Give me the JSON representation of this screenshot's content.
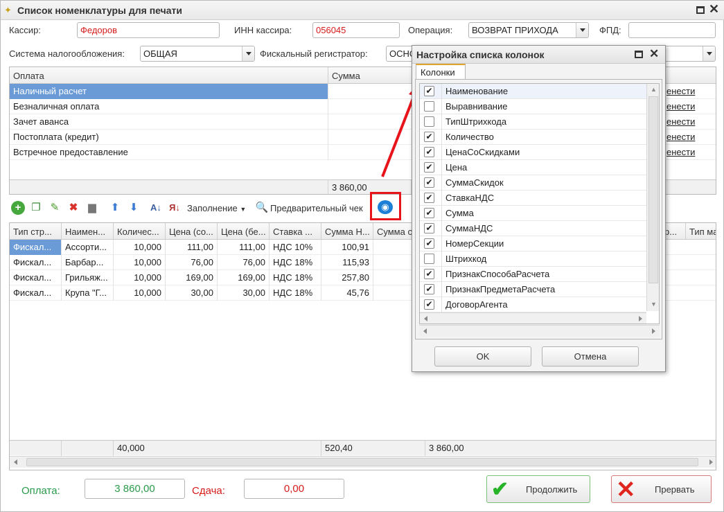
{
  "window": {
    "title": "Список номенклатуры для печати"
  },
  "form": {
    "cashier_label": "Кассир:",
    "cashier_value": "Федоров",
    "inn_label": "ИНН кассира:",
    "inn_value": "056045",
    "operation_label": "Операция:",
    "operation_value": "ВОЗВРАТ ПРИХОДА",
    "fpd_label": "ФПД:",
    "fpd_value": "",
    "tax_label": "Система налогообложения:",
    "tax_value": "ОБЩАЯ",
    "registrar_label": "Фискальный регистратор:",
    "registrar_value": "ОСНО"
  },
  "payments": {
    "headers": [
      "Оплата",
      "Сумма"
    ],
    "rows": [
      {
        "name": "Наличный расчет",
        "link": "енести"
      },
      {
        "name": "Безналичная оплата",
        "link": "енести"
      },
      {
        "name": "Зачет аванса",
        "link": "енести"
      },
      {
        "name": "Постоплата (кредит)",
        "link": "енести"
      },
      {
        "name": "Встречное предоставление",
        "link": "енести"
      }
    ],
    "total": "3 860,00"
  },
  "toolbar": {
    "fill_label": "Заполнение",
    "preview_label": "Предварительный чек"
  },
  "items": {
    "headers": [
      "Тип стр...",
      "Наимен...",
      "Количес...",
      "Цена (со...",
      "Цена (бе...",
      "Ставка ...",
      "Сумма Н...",
      "Сумма с",
      "р...",
      "Тип ма"
    ],
    "rows": [
      [
        "Фискал...",
        "Ассорти...",
        "10,000",
        "111,00",
        "111,00",
        "НДС 10%",
        "100,91"
      ],
      [
        "Фискал...",
        "Барбар...",
        "10,000",
        "76,00",
        "76,00",
        "НДС 18%",
        "115,93"
      ],
      [
        "Фискал...",
        "Грильяж...",
        "10,000",
        "169,00",
        "169,00",
        "НДС 18%",
        "257,80"
      ],
      [
        "Фискал...",
        "Крупа \"Г...",
        "10,000",
        "30,00",
        "30,00",
        "НДС 18%",
        "45,76"
      ]
    ],
    "totals": {
      "qty": "40,000",
      "sum_n": "520,40",
      "sum_c": "3 860,00"
    }
  },
  "bottom": {
    "payment_label": "Оплата:",
    "payment_value": "3 860,00",
    "change_label": "Сдача:",
    "change_value": "0,00",
    "continue_label": "Продолжить",
    "abort_label": "Прервать"
  },
  "dialog": {
    "title": "Настройка списка колонок",
    "tab": "Колонки",
    "columns": [
      {
        "name": "Наименование",
        "checked": true
      },
      {
        "name": "Выравнивание",
        "checked": false
      },
      {
        "name": "ТипШтрихкода",
        "checked": false
      },
      {
        "name": "Количество",
        "checked": true
      },
      {
        "name": "ЦенаСоСкидками",
        "checked": true
      },
      {
        "name": "Цена",
        "checked": true
      },
      {
        "name": "СуммаСкидок",
        "checked": true
      },
      {
        "name": "СтавкаНДС",
        "checked": true
      },
      {
        "name": "Сумма",
        "checked": true
      },
      {
        "name": "СуммаНДС",
        "checked": true
      },
      {
        "name": "НомерСекции",
        "checked": true
      },
      {
        "name": "Штрихкод",
        "checked": false
      },
      {
        "name": "ПризнакСпособаРасчета",
        "checked": true
      },
      {
        "name": "ПризнакПредметаРасчета",
        "checked": true
      },
      {
        "name": "ДоговорАгента",
        "checked": true
      }
    ],
    "ok_label": "OK",
    "cancel_label": "Отмена"
  },
  "colors": {
    "selection": "#6b9bd6",
    "highlight": "#e8141b",
    "green": "#2a9a4a",
    "red": "#d61b1b"
  }
}
